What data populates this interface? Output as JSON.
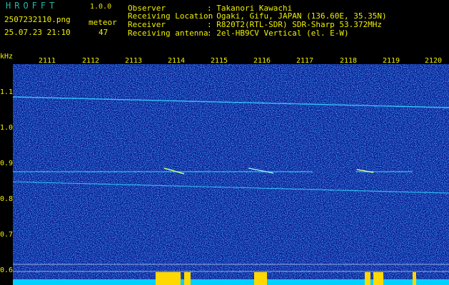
{
  "header": {
    "app_title": "HROFFT",
    "version": "1.0.0",
    "filename": "2507232110.png",
    "datetime": "25.07.23 21:10",
    "meteor_label": "meteor",
    "meteor_count": "47",
    "info": [
      {
        "label": "Observer",
        "value": ": Takanori Kawachi"
      },
      {
        "label": "Receiving Location",
        "value": ": Ogaki, Gifu, JAPAN (136.60E, 35.35N)"
      },
      {
        "label": "Receiver",
        "value": ": R820T2(RTL-SDR) SDR-Sharp 53.372MHz"
      },
      {
        "label": "Receiving antenna",
        "value": ": 2el-HB9CV Vertical (el. E-W)"
      }
    ]
  },
  "axes": {
    "y_unit": "kHz",
    "x_ticks": [
      "2111",
      "2112",
      "2113",
      "2114",
      "2115",
      "2116",
      "2117",
      "2118",
      "2119",
      "2120"
    ],
    "y_ticks": [
      "1.1",
      "1.0",
      "0.9",
      "0.8",
      "0.7",
      "0.6"
    ]
  },
  "colors": {
    "background": "#0a168a",
    "text": "#f0f000",
    "signal": "#35d2ff",
    "meteor_bursts": "#ffd800",
    "noise_floor": "#00d0ff"
  }
}
